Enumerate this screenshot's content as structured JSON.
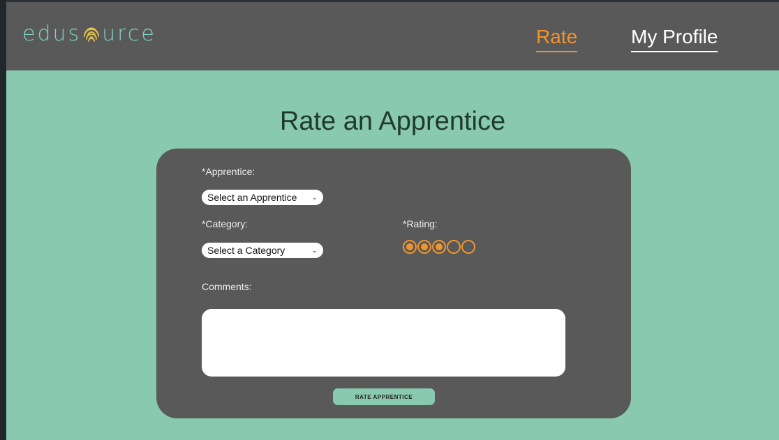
{
  "brand": {
    "logo_left": "edus",
    "logo_right": "urce",
    "logo_icon": "fingerprint-icon",
    "logo_color": "#7ed3c2",
    "fingerprint_color": "#e2c24a"
  },
  "nav": {
    "rate_label": "Rate",
    "profile_label": "My Profile",
    "active": "Rate"
  },
  "page": {
    "title": "Rate an Apprentice"
  },
  "form": {
    "apprentice_label": "*Apprentice:",
    "apprentice_select": "Select an Apprentice",
    "category_label": "*Category:",
    "category_select": "Select a Category",
    "rating_label": "*Rating:",
    "rating_selected": 3,
    "rating_max": 5,
    "comments_label": "Comments:",
    "comments_value": "",
    "submit_label": "RATE APPRENTICE"
  },
  "colors": {
    "background": "#88c9af",
    "navbar": "#595959",
    "card": "#595959",
    "accent": "#f0952e",
    "title": "#1f3a2e"
  }
}
